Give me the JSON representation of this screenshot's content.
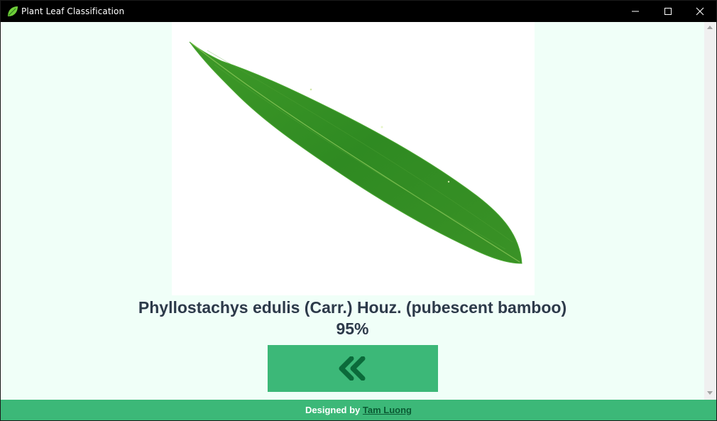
{
  "window": {
    "title": "Plant Leaf Classification",
    "icon": "leaf-icon",
    "controls": [
      "minimize-icon",
      "maximize-icon",
      "close-icon"
    ]
  },
  "result": {
    "image_alt": "leaf-image",
    "species": "Phyllostachys edulis (Carr.) Houz. (pubescent bamboo)",
    "confidence": "95%"
  },
  "back_button": {
    "icon": "double-chevron-left-icon"
  },
  "footer": {
    "prefix": "Designed by",
    "author": "Tam Luong"
  },
  "colors": {
    "accent": "#3cb878",
    "background": "#f0fff8",
    "text": "#2d3a4a",
    "titlebar": "#000000",
    "icon_dark": "#0b6a3a"
  }
}
